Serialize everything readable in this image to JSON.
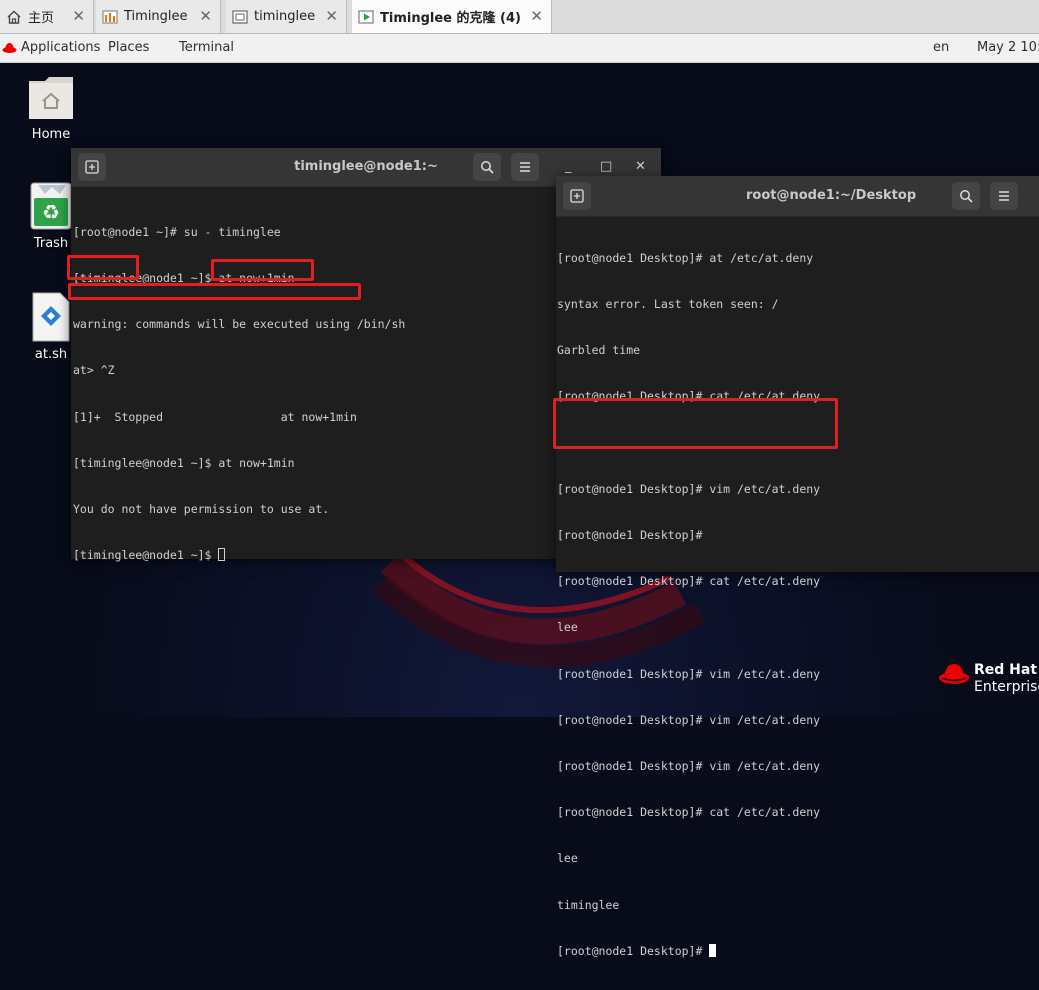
{
  "tabs": [
    {
      "label": "主页",
      "icon": "home-icon"
    },
    {
      "label": "Timinglee",
      "icon": "vm-running-icon"
    },
    {
      "label": "timinglee",
      "icon": "vm-window-icon"
    },
    {
      "label": "Timinglee 的克隆 (4)",
      "icon": "vm-play-icon",
      "active": true
    }
  ],
  "topbar": {
    "applications": "Applications",
    "places": "Places",
    "terminal": "Terminal",
    "lang": "en",
    "clock": "May 2  10:"
  },
  "desktop": {
    "icons": [
      {
        "label": "Home",
        "icon": "home-folder-icon"
      },
      {
        "label": "Trash",
        "icon": "trash-icon"
      },
      {
        "label": "at.sh",
        "icon": "script-file-icon"
      }
    ],
    "brand_line1": "Red Hat",
    "brand_line2": "Enterprise"
  },
  "terminal_left": {
    "title": "timinglee@node1:~",
    "lines": [
      "[root@node1 ~]# su - timinglee",
      "[timinglee@node1 ~]$ at now+1min",
      "warning: commands will be executed using /bin/sh",
      "at> ^Z",
      "[1]+  Stopped                 at now+1min",
      "[timinglee@node1 ~]$ at now+1min",
      "You do not have permission to use at.",
      "[timinglee@node1 ~]$ "
    ]
  },
  "terminal_right": {
    "title": "root@node1:~/Desktop",
    "lines": [
      "[root@node1 Desktop]# at /etc/at.deny",
      "syntax error. Last token seen: /",
      "Garbled time",
      "[root@node1 Desktop]# cat /etc/at.deny",
      "",
      "[root@node1 Desktop]# vim /etc/at.deny",
      "[root@node1 Desktop]#",
      "[root@node1 Desktop]# cat /etc/at.deny",
      "lee",
      "[root@node1 Desktop]# vim /etc/at.deny",
      "[root@node1 Desktop]# vim /etc/at.deny",
      "[root@node1 Desktop]# vim /etc/at.deny",
      "[root@node1 Desktop]# cat /etc/at.deny",
      "lee",
      "timinglee",
      "[root@node1 Desktop]# "
    ]
  },
  "colors": {
    "highlight": "#e02020",
    "terminal_bg": "#1e1e1e",
    "terminal_header": "#353535",
    "redhat_red": "#ee0000"
  }
}
